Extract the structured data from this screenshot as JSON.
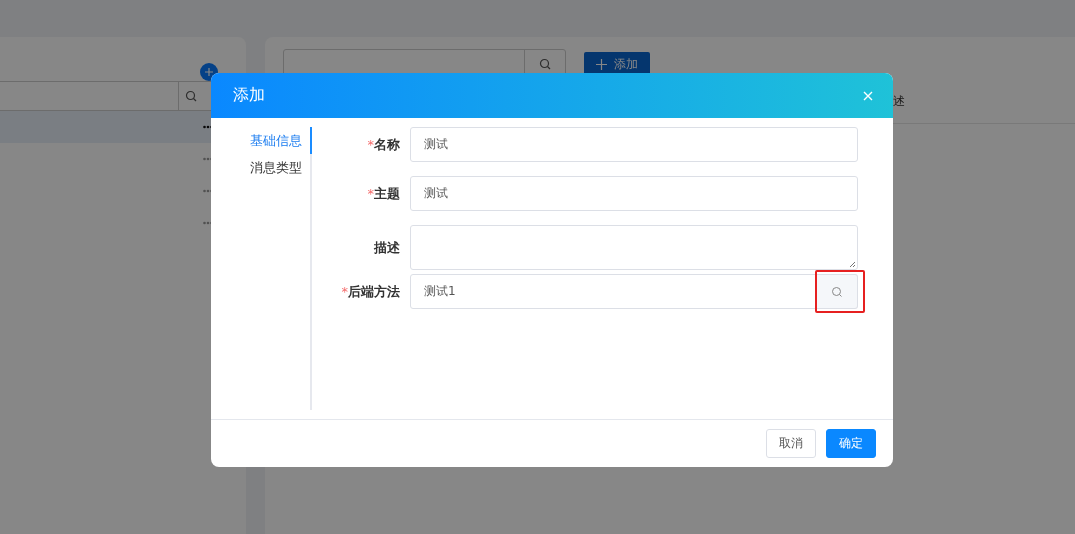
{
  "left_panel": {
    "rows": [
      {
        "selected": true
      },
      {
        "selected": false
      },
      {
        "selected": false
      },
      {
        "selected": false
      }
    ]
  },
  "right_panel": {
    "add_button": "添加",
    "column_header": "述"
  },
  "dialog": {
    "title": "添加",
    "nav": [
      {
        "label": "基础信息",
        "selected": true
      },
      {
        "label": "消息类型",
        "selected": false
      }
    ],
    "fields": [
      {
        "kind": "input",
        "label": "名称",
        "required_mark": "*",
        "value": "测试"
      },
      {
        "kind": "input",
        "label": "主题",
        "required_mark": "*",
        "value": "测试"
      },
      {
        "kind": "textarea",
        "label": "描述"
      },
      {
        "kind": "lookup",
        "label": "后端方法",
        "required_mark": "*",
        "value": "测试1",
        "highlighted": true
      }
    ],
    "buttons": [
      {
        "label": "取消",
        "kind": "default"
      },
      {
        "label": "确定",
        "kind": "primary"
      }
    ]
  }
}
